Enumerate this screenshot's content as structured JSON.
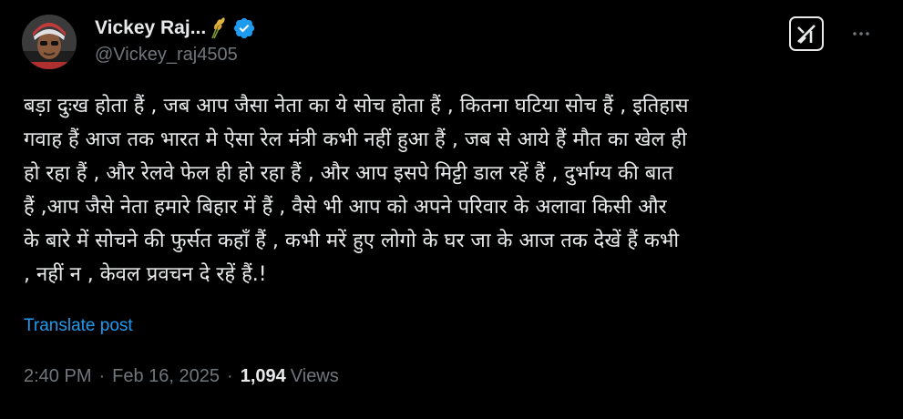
{
  "author": {
    "name": "Vickey Raj...",
    "handle": "@Vickey_raj4505",
    "verified": true,
    "name_emoji": "sheaf-of-rice-icon",
    "verified_color": "#1d9bf0"
  },
  "header": {
    "grok_icon": "grok-icon",
    "more_icon": "more-options-icon"
  },
  "post": {
    "lines": [
      "बड़ा दुःख होता हैं , जब आप जैसा नेता का ये सोच होता हैं , कितना घटिया सोच हैं , इतिहास",
      "गवाह हैं आज तक भारत मे ऐसा रेल मंत्री कभी नहीं हुआ हैं , जब से आये हैं मौत का खेल ही",
      "हो रहा हैं , और रेलवे फेल ही हो रहा हैं , और आप इसपे मिट्टी डाल रहें हैं , दुर्भाग्य की बात",
      "हैं ,आप जैसे नेता हमारे बिहार में हैं , वैसे भी आप को अपने परिवार के अलावा किसी और",
      "के बारे में सोचने की फुर्सत कहाँ हैं , कभी मरें हुए लोगो के घर जा के आज तक देखें हैं कभी",
      ", नहीं न , केवल प्रवचन दे रहें हैं.!"
    ],
    "translate_label": "Translate post"
  },
  "meta": {
    "time": "2:40 PM",
    "separator": "·",
    "date": "Feb 16, 2025",
    "views_count": "1,094",
    "views_label": "Views"
  },
  "colors": {
    "background": "#000000",
    "text": "#e7e9ea",
    "muted": "#71767b",
    "link": "#1d9bf0"
  }
}
